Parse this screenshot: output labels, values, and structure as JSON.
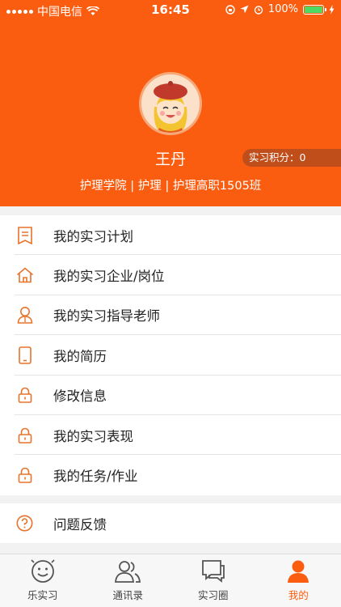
{
  "status_bar": {
    "carrier": "中国电信",
    "time": "16:45",
    "battery": "100%"
  },
  "profile": {
    "name": "王丹",
    "points_label": "实习积分：0",
    "department": "护理学院 | 护理 | 护理高职1505班"
  },
  "menu": {
    "items": [
      {
        "label": "我的实习计划",
        "icon": "document-icon"
      },
      {
        "label": "我的实习企业/岗位",
        "icon": "home-icon"
      },
      {
        "label": "我的实习指导老师",
        "icon": "person-icon"
      },
      {
        "label": "我的简历",
        "icon": "phone-icon"
      },
      {
        "label": "修改信息",
        "icon": "lock-icon"
      },
      {
        "label": "我的实习表现",
        "icon": "lock-icon"
      },
      {
        "label": "我的任务/作业",
        "icon": "lock-icon"
      }
    ],
    "feedback": {
      "label": "问题反馈",
      "icon": "question-icon"
    }
  },
  "tabbar": {
    "tabs": [
      {
        "label": "乐实习",
        "icon": "smile-icon"
      },
      {
        "label": "通讯录",
        "icon": "contacts-icon"
      },
      {
        "label": "实习圈",
        "icon": "chat-icon"
      },
      {
        "label": "我的",
        "icon": "user-icon"
      }
    ],
    "active": "我的"
  },
  "colors": {
    "accent": "#fb5d10",
    "background": "#f2f2f2"
  }
}
